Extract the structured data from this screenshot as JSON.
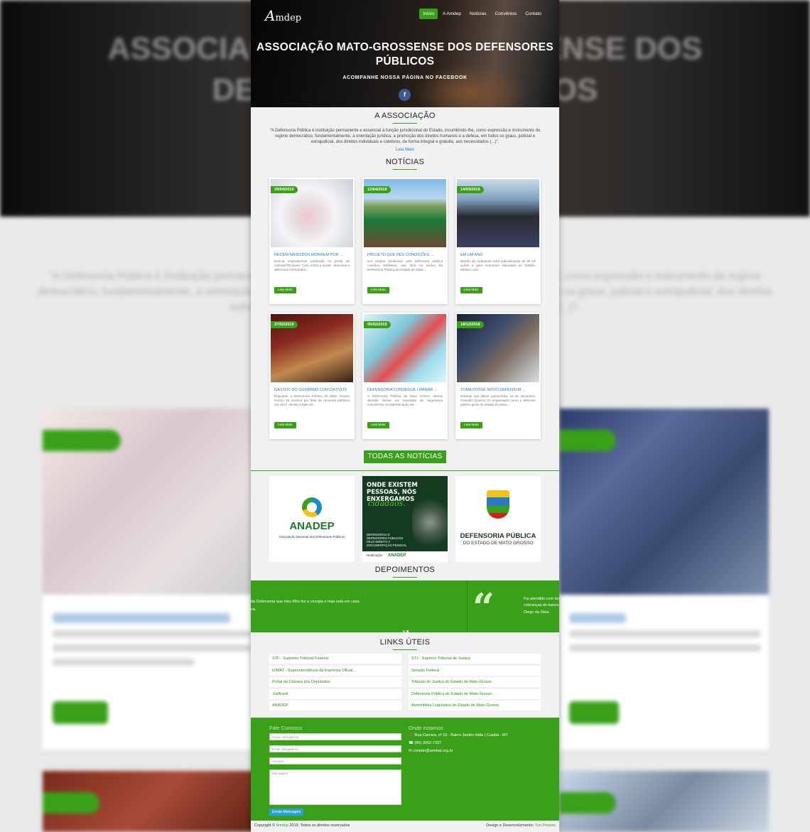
{
  "nav": {
    "logo_letter": "A",
    "logo_text": "mdep",
    "items": [
      "Início",
      "A Amdep",
      "Notícias",
      "Convênios",
      "Contato"
    ]
  },
  "hero": {
    "title": "ASSOCIAÇÃO MATO-GROSSENSE DOS DEFENSORES PÚBLICOS",
    "subtitle": "ACOMPANHE NOSSA PÁGINA NO FACEBOOK",
    "facebook_glyph": "f"
  },
  "association": {
    "title": "A ASSOCIAÇÃO",
    "text": "\"A Defensoria Pública é instituição permanente e essencial à função jurisdicional do Estado, incumbindo-lhe, como expressão e instrumento do regime democrático, fundamentalmente, a orientação jurídica, a promoção dos direitos humanos e a defesa, em todos os graus, judicial e extrajudicial, dos direitos individuais e coletivos, de forma integral e gratuita, aos necessitados (...)\".",
    "more": "Leia Mais"
  },
  "news": {
    "title": "NOTÍCIAS",
    "read_more": "Leia Mais",
    "items": [
      {
        "date": "29/04/2019",
        "title": "RECÉM-NASCIDOS MORREM POR ...",
        "text": "Notícia originalmente publicada no portal de notícias RD News \"Luta contra a morte\", descreve a defensora Alessandra..."
      },
      {
        "date": "12/04/2019",
        "title": "PROJETO QUE DEU CONDIÇÕES ...",
        "text": "Um projeto idealizado pela defensora pública Carolina Welikewó, que atua no núcleo da Defensoria Pública do Estado de Mato..."
      },
      {
        "date": "14/03/2019",
        "title": "EM UM ANO",
        "text": "Balcão da Cidadania evita judicialização de 35 mil ações e gera economia milionária ao Estado. Mesmo com..."
      },
      {
        "date": "27/02/2019",
        "title": "GASTOS DO GOVERNO COM DATIVOS ...",
        "text": "Enquanto a Defensoria Pública de Mato Grosso fechou 15 núcleos por falta de recursos públicos em 2017, devido à falta de..."
      },
      {
        "date": "05/02/2019",
        "title": "DEFENSORIA CONSEGUE LIMINAR ...",
        "text": "A Defensoria Pública de Mato Grosso obteve decisão liminar em Mandado de Segurança consistente na determinação de..."
      },
      {
        "date": "18/12/2018",
        "title": "TOMA POSSE NOVO DEFENSOR ...",
        "text": "Durante sua última quinta-feira, 13 de dezembro, Oswaldo Queiroz foi empossado como o defensor público geral do estado de Mato..."
      }
    ],
    "all_button": "TODAS AS NOTÍCIAS"
  },
  "partners": {
    "anadep_name": "ANADEP",
    "anadep_sub": "Associação Nacional dos Defensores Públicos",
    "campaign_head": "ONDE EXISTEM PESSOAS, NÓS ENXERGAMOS",
    "campaign_script": "cidadãos.",
    "campaign_small": "DEFENSORAS E DEFENSORES PÚBLICOS PELO DIREITO À DOCUMENTAÇÃO PESSOAL",
    "campaign_footer_label": "Realização",
    "campaign_footer_org": "ANADEP",
    "defensoria_name": "DEFENSORIA PÚBLICA",
    "defensoria_sub": "DO ESTADO DE MATO GROSSO"
  },
  "testimonials": {
    "title": "DEPOIMENTOS",
    "left_line1": "da Defensoria que meu filho fez a cirurgia e hoje está em casa.",
    "left_line2": "va.",
    "right_line1": "Fui atendido com todo cobranças do banco",
    "right_line2": "Diego da Silva.",
    "quote_glyph": "“"
  },
  "links": {
    "title": "LINKS ÚTEIS",
    "left": [
      "STF - Supremo Tribunal Federal",
      "IOMAT - Superintendência da Imprensa Oficial...",
      "Portal da Câmara dos Deputados",
      "JusBrasil",
      "ANADEP"
    ],
    "right": [
      "STJ - Superior Tribunal de Justiça",
      "Senado Federal",
      "Tribunal de Justiça do Estado de Mato-Grosso",
      "Defensoria Pública do Estado de Mato-Grosso",
      "Assembléia Legislativa do Estado de Mato-Grosso"
    ]
  },
  "contact": {
    "title": "Fale Conosco",
    "name_placeholder": "Nome (obrigatório)",
    "email_placeholder": "Email (obrigatório)",
    "subject_placeholder": "Assunto",
    "message_placeholder": "Mensagem",
    "send": "Enviar Mensagem",
    "where_title": "Onde estamos",
    "address": "Rua Carrara, nº 10 - Bairro Jardim Itália | Cuiabá - MT",
    "phone": "(65) 3052-7337",
    "email": "contato@amdep.org.br",
    "address_icon": "📍",
    "phone_icon": "☎",
    "email_icon": "✉"
  },
  "footer": {
    "copyright_prefix": "Copyright ©",
    "brand": "Amdep",
    "copyright_suffix": "2019. Todos os direitos reservados",
    "credit_prefix": "Design e Desenvolvimento:",
    "credit_name": "Yuri Peixoto"
  }
}
